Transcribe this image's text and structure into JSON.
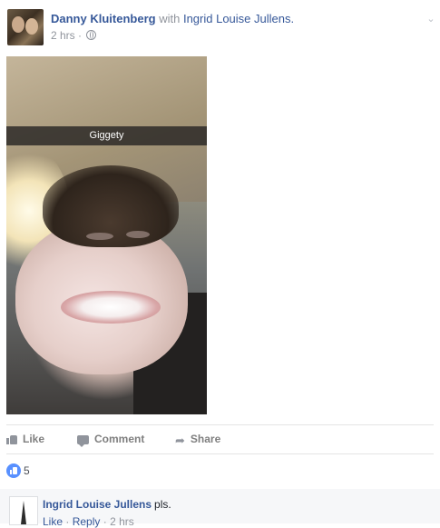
{
  "post": {
    "author": "Danny Kluitenberg",
    "with_text": "with",
    "tagged": "Ingrid Louise Jullens.",
    "time": "2 hrs",
    "separator": "·",
    "privacy_icon": "globe-icon",
    "menu_icon": "chevron-down-icon"
  },
  "photo": {
    "caption": "Giggety"
  },
  "actions": {
    "like_label": "Like",
    "comment_label": "Comment",
    "share_label": "Share"
  },
  "reactions": {
    "icon": "like-badge-icon",
    "count": "5"
  },
  "comment": {
    "author": "Ingrid Louise Jullens",
    "text": "pls.",
    "like_label": "Like",
    "separator": "·",
    "reply_label": "Reply",
    "time": "2 hrs"
  },
  "colors": {
    "link": "#365899",
    "meta": "#90949c",
    "like_badge": "#5890ff"
  }
}
